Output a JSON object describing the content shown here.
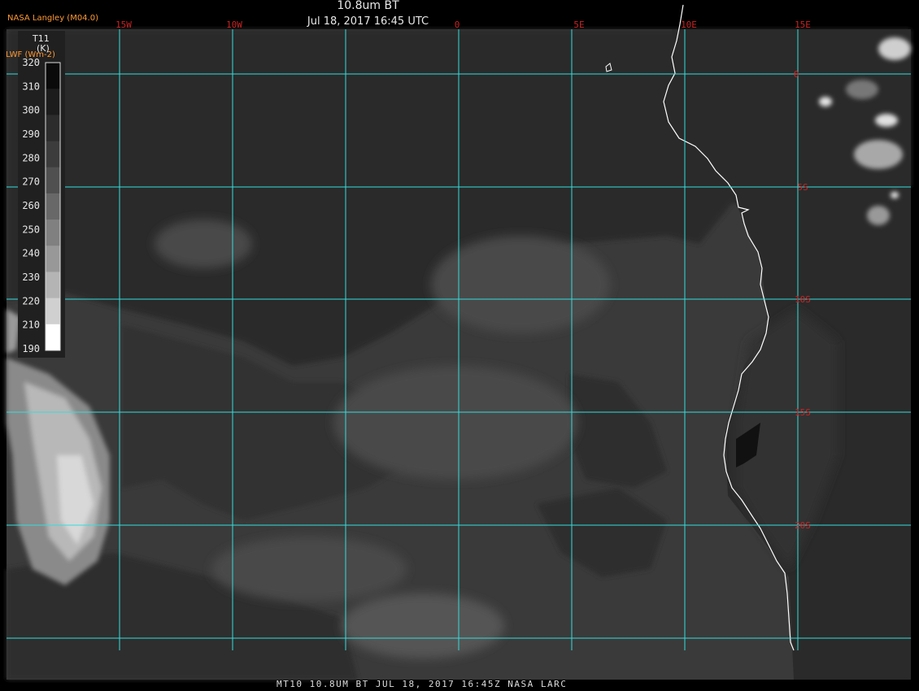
{
  "header": {
    "title": "10.8um BT",
    "timestamp": "Jul 18, 2017 16:45 UTC",
    "organization": "NASA Langley (M04.0)",
    "units_label": "LWF (Wm-2)"
  },
  "footer": {
    "caption": "MT10  10.8UM BT   JUL 18, 2017 16:45Z   NASA LARC"
  },
  "colorbar": {
    "variable": "T11",
    "unit": "(K)",
    "ticks": [
      "320",
      "310",
      "300",
      "290",
      "280",
      "270",
      "260",
      "250",
      "240",
      "230",
      "220",
      "210",
      "190"
    ]
  },
  "grid": {
    "longitude_labels": [
      "15W",
      "10W",
      "0",
      "5E",
      "10E",
      "15E"
    ],
    "latitude_labels": [
      "0",
      "5S",
      "10S",
      "15S",
      "20S"
    ]
  },
  "colors": {
    "gridline": "#33dddd",
    "grid_label": "#cc2222",
    "coastline": "#ffffff",
    "ocean_base": "#3c3c3c"
  }
}
